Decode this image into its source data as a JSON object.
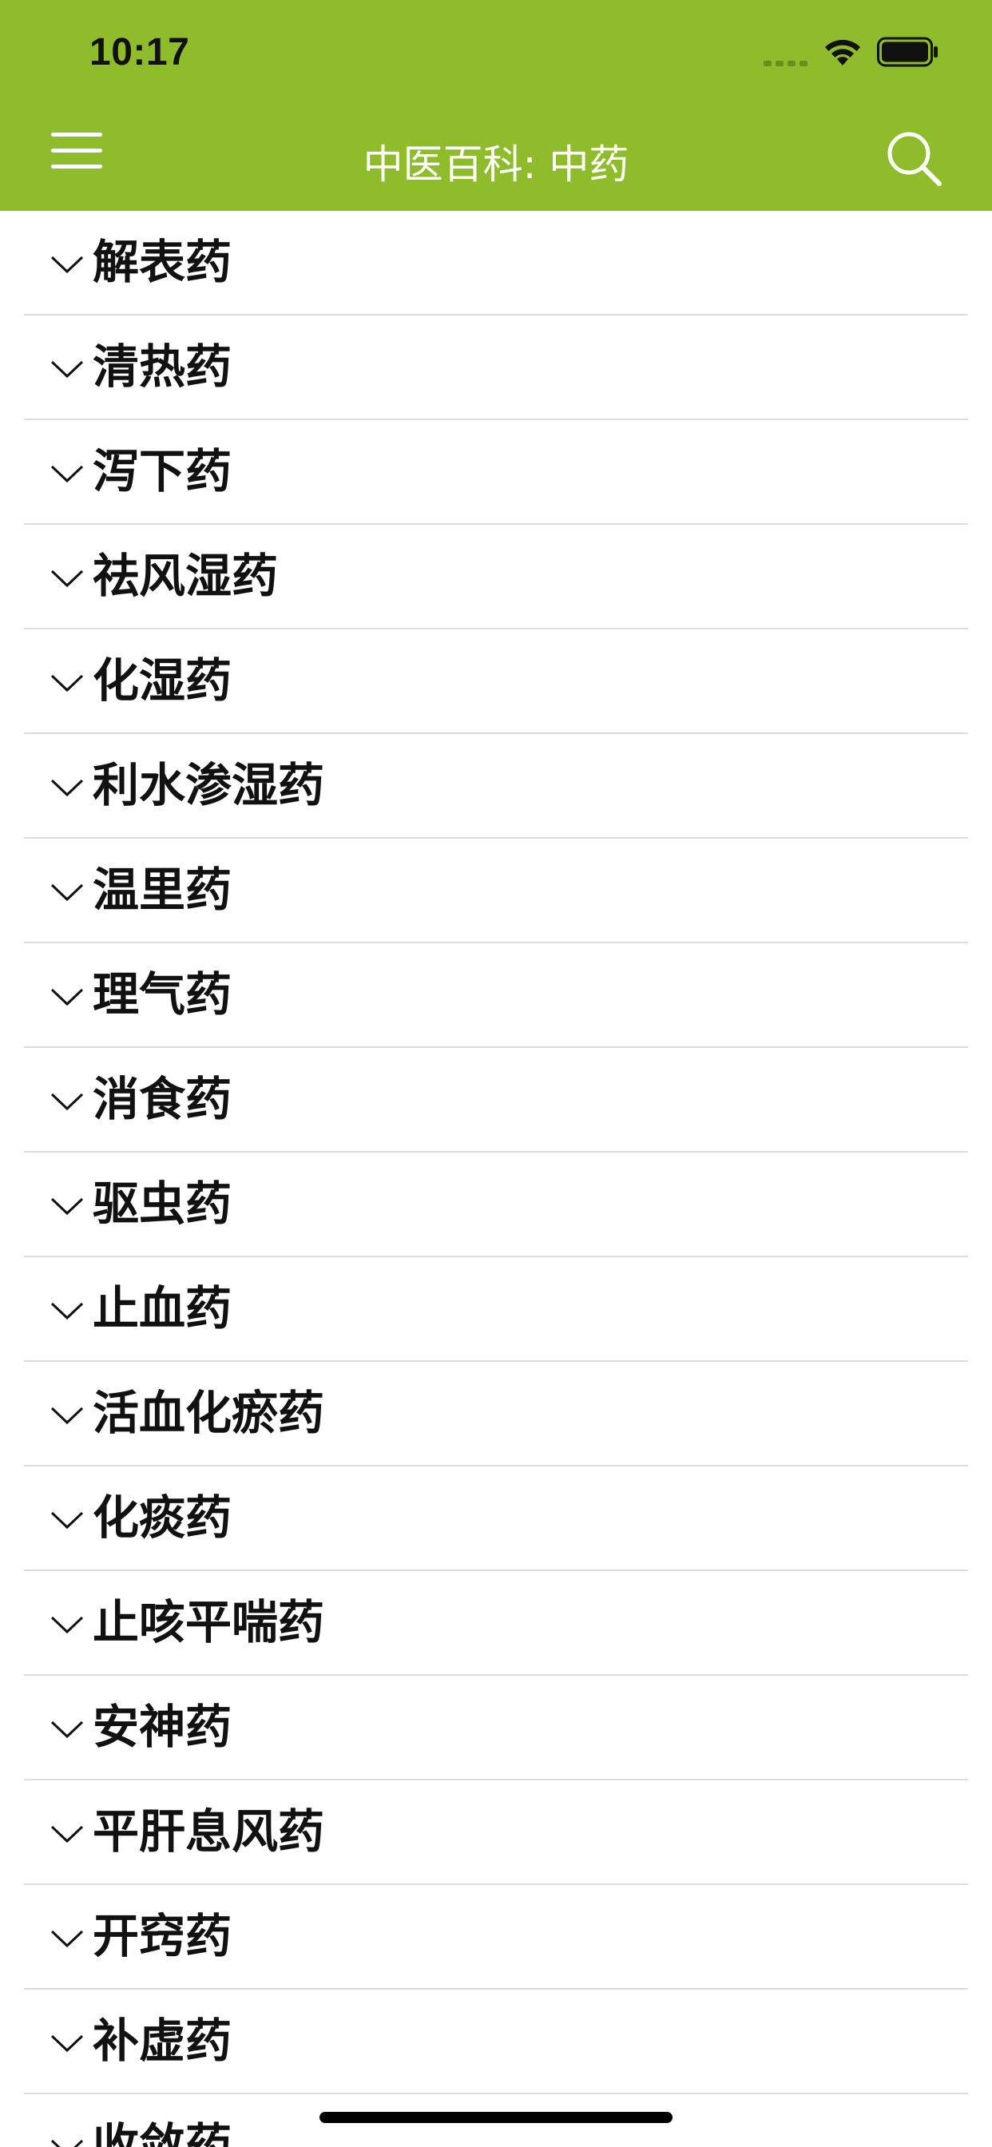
{
  "status_bar": {
    "time": "10:17",
    "icons": [
      "signal-icon",
      "wifi-icon",
      "battery-icon"
    ]
  },
  "header": {
    "title": "中医百科: 中药",
    "menu_icon": "hamburger-menu-icon",
    "search_icon": "search-icon",
    "background_color": "#8fbc2b"
  },
  "categories": [
    {
      "label": "解表药"
    },
    {
      "label": "清热药"
    },
    {
      "label": "泻下药"
    },
    {
      "label": "祛风湿药"
    },
    {
      "label": "化湿药"
    },
    {
      "label": "利水渗湿药"
    },
    {
      "label": "温里药"
    },
    {
      "label": "理气药"
    },
    {
      "label": "消食药"
    },
    {
      "label": "驱虫药"
    },
    {
      "label": "止血药"
    },
    {
      "label": "活血化瘀药"
    },
    {
      "label": "化痰药"
    },
    {
      "label": "止咳平喘药"
    },
    {
      "label": "安神药"
    },
    {
      "label": "平肝息风药"
    },
    {
      "label": "开窍药"
    },
    {
      "label": "补虚药"
    },
    {
      "label": "收敛药"
    }
  ]
}
